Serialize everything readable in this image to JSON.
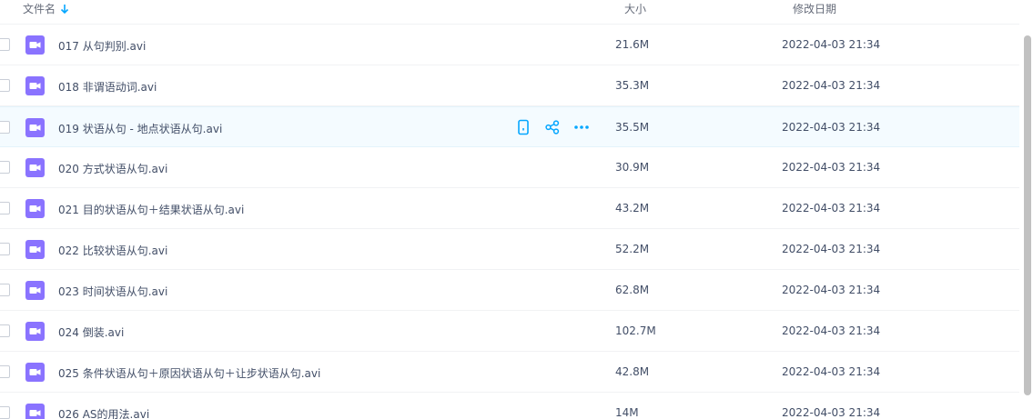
{
  "header": {
    "name_label": "文件名",
    "size_label": "大小",
    "date_label": "修改日期",
    "sort_icon": "arrow-down-icon"
  },
  "colors": {
    "accent": "#06a7ff",
    "video_icon": "#8a73ff",
    "hover_row": "#f4fbff"
  },
  "files": [
    {
      "name": "017 从句判别.avi",
      "size": "21.6M",
      "date": "2022-04-03 21:34"
    },
    {
      "name": "018 非谓语动词.avi",
      "size": "35.3M",
      "date": "2022-04-03 21:34"
    },
    {
      "name": "019 状语从句 - 地点状语从句.avi",
      "size": "35.5M",
      "date": "2022-04-03 21:34"
    },
    {
      "name": "020 方式状语从句.avi",
      "size": "30.9M",
      "date": "2022-04-03 21:34"
    },
    {
      "name": "021 目的状语从句＋结果状语从句.avi",
      "size": "43.2M",
      "date": "2022-04-03 21:34"
    },
    {
      "name": "022 比较状语从句.avi",
      "size": "52.2M",
      "date": "2022-04-03 21:34"
    },
    {
      "name": "023 时间状语从句.avi",
      "size": "62.8M",
      "date": "2022-04-03 21:34"
    },
    {
      "name": "024 倒装.avi",
      "size": "102.7M",
      "date": "2022-04-03 21:34"
    },
    {
      "name": "025 条件状语从句＋原因状语从句＋让步状语从句.avi",
      "size": "42.8M",
      "date": "2022-04-03 21:34"
    },
    {
      "name": "026 AS的用法.avi",
      "size": "14M",
      "date": "2022-04-03 21:34"
    }
  ],
  "row_actions": [
    "phone-icon",
    "share-icon",
    "more-icon"
  ]
}
